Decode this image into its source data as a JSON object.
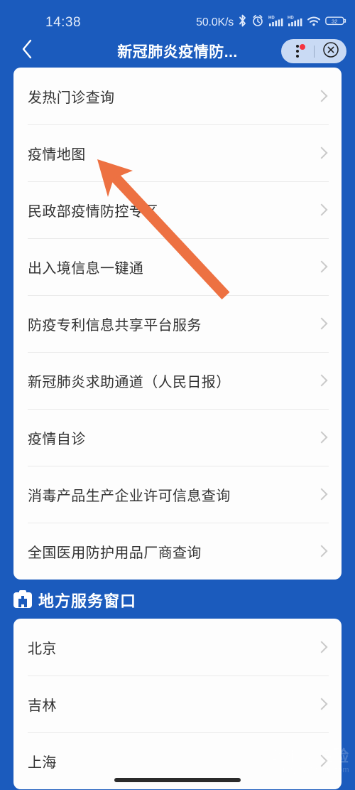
{
  "status_bar": {
    "time": "14:38",
    "net_speed": "50.0K/s",
    "icons": [
      "bluetooth-icon",
      "alarm-clock-icon",
      "hd-signal-icon",
      "hd-signal-icon",
      "wifi-icon",
      "battery-icon"
    ],
    "battery_level": "32"
  },
  "nav_bar": {
    "back_icon": "chevron-left-icon",
    "title": "新冠肺炎疫情防...",
    "menu_icon": "three-dots-icon",
    "close_icon": "close-circle-icon",
    "has_notification_dot": true
  },
  "national_services": {
    "items": [
      {
        "label": "发热门诊查询",
        "chevron": "chevron-right-icon"
      },
      {
        "label": "疫情地图",
        "chevron": "chevron-right-icon"
      },
      {
        "label": "民政部疫情防控专区",
        "chevron": "chevron-right-icon"
      },
      {
        "label": "出入境信息一键通",
        "chevron": "chevron-right-icon"
      },
      {
        "label": "防疫专利信息共享平台服务",
        "chevron": "chevron-right-icon"
      },
      {
        "label": "新冠肺炎求助通道（人民日报）",
        "chevron": "chevron-right-icon"
      },
      {
        "label": "疫情自诊",
        "chevron": "chevron-right-icon"
      },
      {
        "label": "消毒产品生产企业许可信息查询",
        "chevron": "chevron-right-icon"
      },
      {
        "label": "全国医用防护用品厂商查询",
        "chevron": "chevron-right-icon"
      }
    ]
  },
  "local_section": {
    "icon": "medical-kit-icon",
    "title": "地方服务窗口",
    "items": [
      {
        "label": "北京",
        "chevron": "chevron-right-icon"
      },
      {
        "label": "吉林",
        "chevron": "chevron-right-icon"
      },
      {
        "label": "上海",
        "chevron": "chevron-right-icon"
      }
    ]
  },
  "annotation": {
    "type": "arrow",
    "color": "#ED7142",
    "points_to": "疫情地图"
  },
  "watermark": {
    "main": "Baidu经验",
    "sub": "jingyan.baidu.com"
  },
  "colors": {
    "background_blue": "#1b5bbd",
    "card_white": "#fdfdfd",
    "text_dark": "#333333",
    "divider": "#eaeaea",
    "chevron_gray": "#c9c9c9",
    "accent_orange": "#ED7142",
    "notification_red": "#f5333f"
  }
}
